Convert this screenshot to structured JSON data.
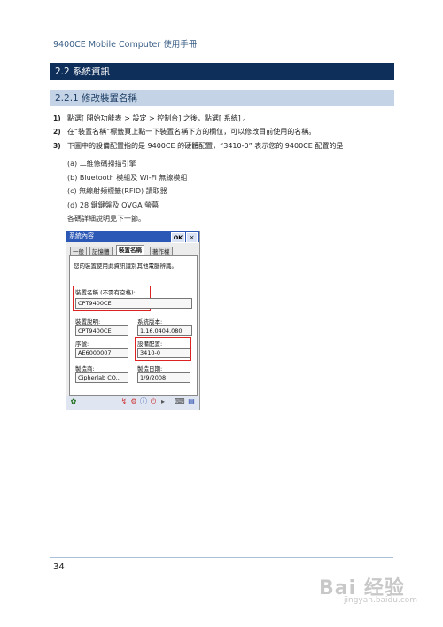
{
  "header": {
    "text": "9400CE Mobile Computer  使用手冊"
  },
  "section": {
    "title": "2.2  系統資訊"
  },
  "subsection": {
    "title": "2.2.1  修改裝置名稱"
  },
  "steps": [
    {
      "num": "1)",
      "text": "點選[ 開始功能表 >   設定  >   控制台] 之後，點選[ 系統] 。"
    },
    {
      "num": "2)",
      "text": "在“裝置名稱”標籤頁上點一下裝置名稱下方的欄位，可以修改目前使用的名稱。"
    },
    {
      "num": "3)",
      "text": "下圖中的設備配置指的是 9400CE 的硬體配置，“3410-0” 表示您的 9400CE 配置的是"
    }
  ],
  "config_items": [
    "(a)  二維條碼掃描引擎",
    "(b)  Bluetooth 模組及 Wi-Fi 無線模組",
    "(c)  無線射頻標籤(RFID) 讀取器",
    "(d)  28 鍵鍵盤及 QVGA 螢幕"
  ],
  "detail_note": "各碼詳細說明見下一節。",
  "device": {
    "window_title": "系統內容",
    "ok_label": "OK",
    "close_label": "×",
    "tabs": [
      "一般",
      "記憶體",
      "裝置名稱",
      "著作權"
    ],
    "intro": "您的裝置使用此資訊識別其他電腦辨識。",
    "name_label": "裝置名稱 (不需有空格):",
    "name_value": "CPT9400CE",
    "desc_label": "裝置說明:",
    "desc_value": "CPT9400CE",
    "version_label": "系統版本:",
    "version_value": "1.16.0404.080",
    "serial_label": "序號:",
    "serial_value": "AE6000007",
    "config_label": "設備配置:",
    "config_value": "3410-0",
    "maker_label": "製造商:",
    "maker_value": "Cipherlab CO.,",
    "date_label": "製造日期:",
    "date_value": "1/9/2008"
  },
  "footer": {
    "page": "34"
  },
  "watermark": {
    "brand": "Bai 经验",
    "url": "jingyan.baidu.com"
  }
}
